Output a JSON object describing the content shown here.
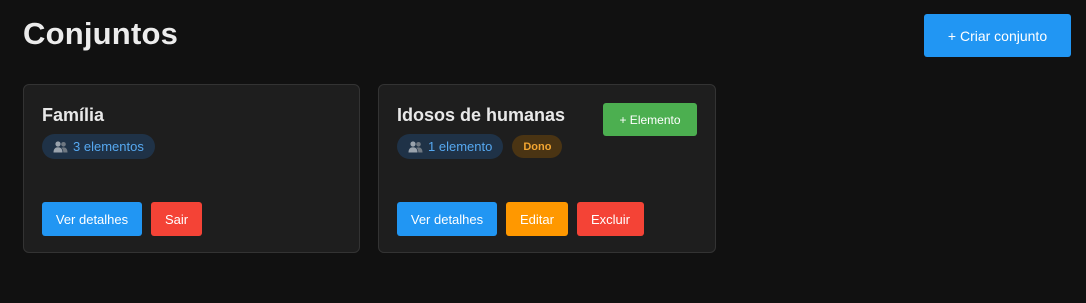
{
  "header": {
    "title": "Conjuntos",
    "create_button": "+ Criar conjunto"
  },
  "icons": {
    "members": "people-icon"
  },
  "colors": {
    "primary": "#2196f3",
    "success": "#4caf50",
    "warning": "#ff9800",
    "danger": "#f44336",
    "badge_text": "#56a8f0",
    "owner_text": "#f2a531"
  },
  "sets": [
    {
      "name": "Família",
      "count_label": "3 elementos",
      "details_button": "Ver detalhes",
      "leave_button": "Sair"
    },
    {
      "name": "Idosos de humanas",
      "count_label": "1 elemento",
      "owner_badge": "Dono",
      "add_element_button": "+ Elemento",
      "details_button": "Ver detalhes",
      "edit_button": "Editar",
      "delete_button": "Excluir"
    }
  ]
}
